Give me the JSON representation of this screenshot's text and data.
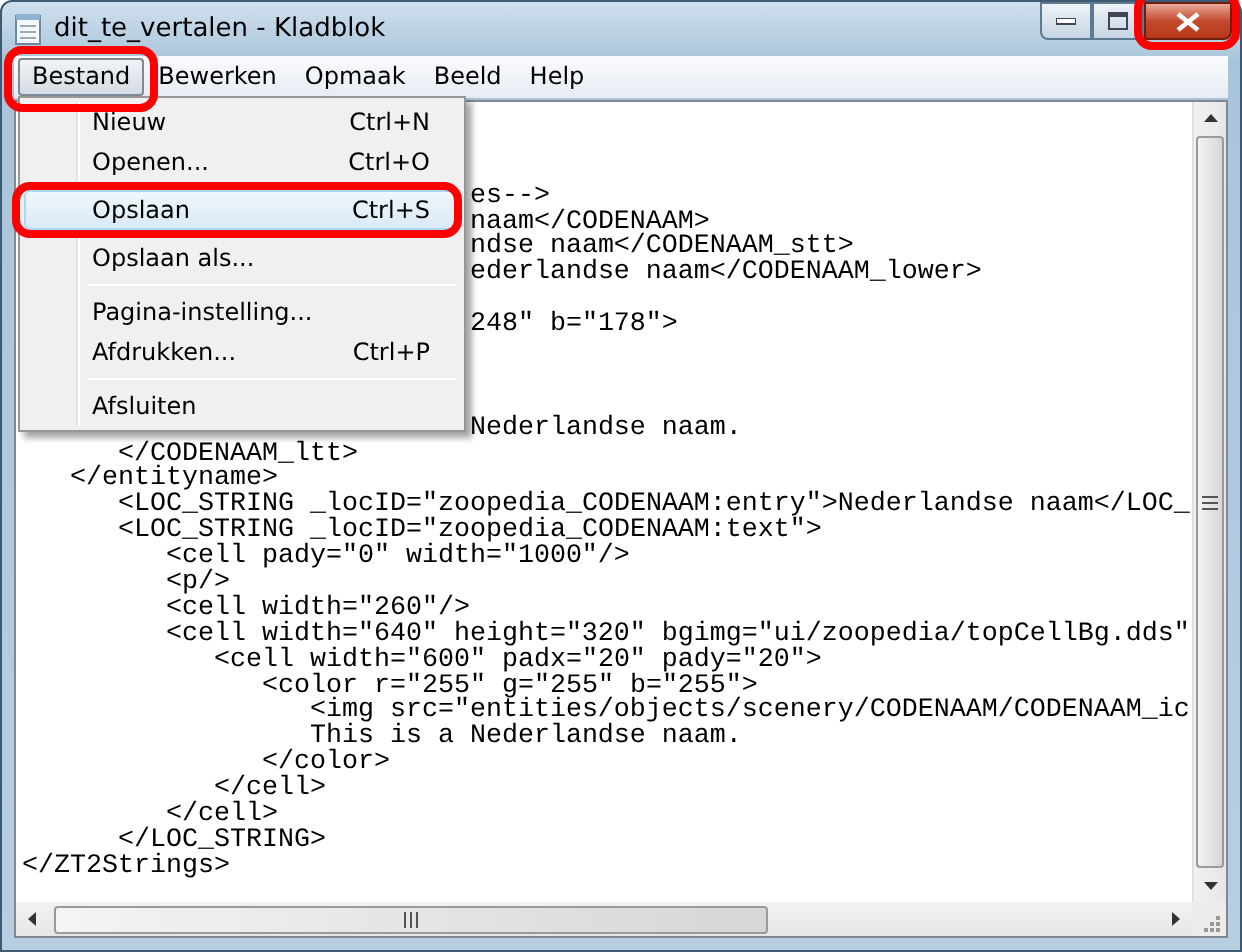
{
  "window": {
    "title": "dit_te_vertalen - Kladblok",
    "close_highlighted": true
  },
  "menubar": [
    {
      "label": "Bestand",
      "selected": true,
      "highlighted": true
    },
    {
      "label": "Bewerken",
      "selected": false,
      "highlighted": false
    },
    {
      "label": "Opmaak",
      "selected": false,
      "highlighted": false
    },
    {
      "label": "Beeld",
      "selected": false,
      "highlighted": false
    },
    {
      "label": "Help",
      "selected": false,
      "highlighted": false
    }
  ],
  "menu": [
    {
      "kind": "item",
      "label": "Nieuw",
      "shortcut": "Ctrl+N",
      "selected": false,
      "highlighted": false
    },
    {
      "kind": "item",
      "label": "Openen...",
      "shortcut": "Ctrl+O",
      "selected": false,
      "highlighted": false
    },
    {
      "kind": "item",
      "label": "Opslaan",
      "shortcut": "Ctrl+S",
      "selected": true,
      "highlighted": true
    },
    {
      "kind": "item",
      "label": "Opslaan als...",
      "selected": false,
      "highlighted": false
    },
    {
      "kind": "separator"
    },
    {
      "kind": "item",
      "label": "Pagina-instelling...",
      "selected": false,
      "highlighted": false
    },
    {
      "kind": "item",
      "label": "Afdrukken...",
      "shortcut": "Ctrl+P",
      "selected": false,
      "highlighted": false
    },
    {
      "kind": "separator"
    },
    {
      "kind": "item",
      "label": "Afsluiten",
      "selected": false,
      "highlighted": false
    }
  ],
  "editor": {
    "text": "\n\n\n                            es-->\n                            naam</CODENAAM>\n                            ndse naam</CODENAAM_stt>\n                            ederlandse naam</CODENAAM_lower>\n\n                            248\" b=\"178\">\n\n\n\n                            Nederlandse naam.\n      </CODENAAM_ltt>\n   </entityname>\n      <LOC_STRING _locID=\"zoopedia_CODENAAM:entry\">Nederlandse naam</LOC_\n      <LOC_STRING _locID=\"zoopedia_CODENAAM:text\">\n         <cell pady=\"0\" width=\"1000\"/>\n         <p/>\n         <cell width=\"260\"/>\n         <cell width=\"640\" height=\"320\" bgimg=\"ui/zoopedia/topCellBg.dds\"\n            <cell width=\"600\" padx=\"20\" pady=\"20\">\n               <color r=\"255\" g=\"255\" b=\"255\">\n                  <img src=\"entities/objects/scenery/CODENAAM/CODENAAM_ic\n                  This is a Nederlandse naam.\n               </color>\n            </cell>\n         </cell>\n      </LOC_STRING>\n</ZT2Strings>"
  }
}
